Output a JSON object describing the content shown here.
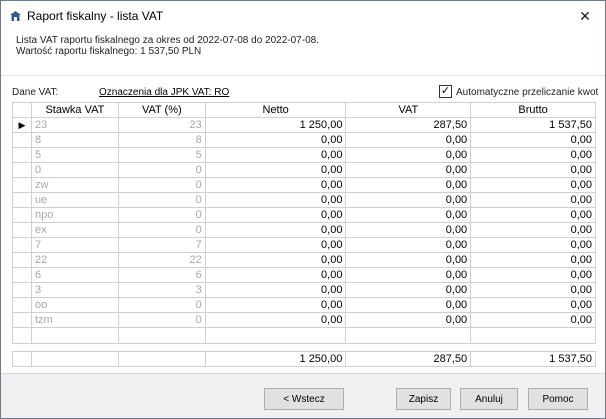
{
  "window": {
    "title": "Raport fiskalny - lista VAT",
    "close_glyph": "✕"
  },
  "info": {
    "line1": "Lista VAT raportu fiskalnego za okres od 2022-07-08 do 2022-07-08.",
    "line2": "Wartość raportu fiskalnego: 1 537,50 PLN"
  },
  "dane_vat": {
    "label": "Dane VAT:",
    "link": "Oznaczenia dla JPK VAT: RO"
  },
  "auto_recalc": {
    "label": "Automatyczne przeliczanie kwot",
    "checked": true,
    "check_glyph": "✓"
  },
  "grid": {
    "current_row_glyph": "▶",
    "columns": [
      "Stawka VAT",
      "VAT (%)",
      "Netto",
      "VAT",
      "Brutto"
    ],
    "rows": [
      {
        "rate": "23",
        "pct": "23",
        "netto": "1 250,00",
        "vat": "287,50",
        "brutto": "1 537,50"
      },
      {
        "rate": "8",
        "pct": "8",
        "netto": "0,00",
        "vat": "0,00",
        "brutto": "0,00"
      },
      {
        "rate": "5",
        "pct": "5",
        "netto": "0,00",
        "vat": "0,00",
        "brutto": "0,00"
      },
      {
        "rate": "0",
        "pct": "0",
        "netto": "0,00",
        "vat": "0,00",
        "brutto": "0,00"
      },
      {
        "rate": "zw",
        "pct": "0",
        "netto": "0,00",
        "vat": "0,00",
        "brutto": "0,00"
      },
      {
        "rate": "ue",
        "pct": "0",
        "netto": "0,00",
        "vat": "0,00",
        "brutto": "0,00"
      },
      {
        "rate": "npo",
        "pct": "0",
        "netto": "0,00",
        "vat": "0,00",
        "brutto": "0,00"
      },
      {
        "rate": "ex",
        "pct": "0",
        "netto": "0,00",
        "vat": "0,00",
        "brutto": "0,00"
      },
      {
        "rate": "7",
        "pct": "7",
        "netto": "0,00",
        "vat": "0,00",
        "brutto": "0,00"
      },
      {
        "rate": "22",
        "pct": "22",
        "netto": "0,00",
        "vat": "0,00",
        "brutto": "0,00"
      },
      {
        "rate": "6",
        "pct": "6",
        "netto": "0,00",
        "vat": "0,00",
        "brutto": "0,00"
      },
      {
        "rate": "3",
        "pct": "3",
        "netto": "0,00",
        "vat": "0,00",
        "brutto": "0,00"
      },
      {
        "rate": "oo",
        "pct": "0",
        "netto": "0,00",
        "vat": "0,00",
        "brutto": "0,00"
      },
      {
        "rate": "tzm",
        "pct": "0",
        "netto": "0,00",
        "vat": "0,00",
        "brutto": "0,00"
      }
    ]
  },
  "totals": {
    "netto": "1 250,00",
    "vat": "287,50",
    "brutto": "1 537,50"
  },
  "buttons": {
    "back": "< Wstecz",
    "save": "Zapisz",
    "cancel": "Anuluj",
    "help": "Pomoc"
  },
  "colors": {
    "inactive_text": "#a8a8a8",
    "grid_line": "#d0d0d0",
    "footer_bg": "#f0f0f0"
  }
}
